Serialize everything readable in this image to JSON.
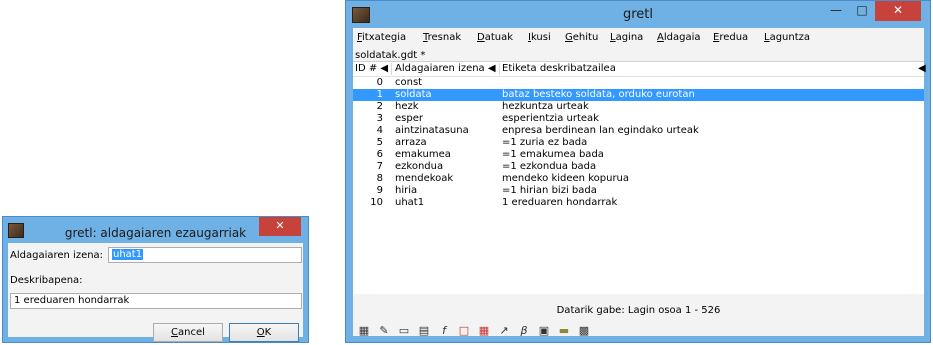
{
  "main_window": {
    "title": "gretl",
    "menus": [
      {
        "label": "Fitxategia",
        "accel": "F",
        "rest": "itxategia"
      },
      {
        "label": "Tresnak",
        "accel": "T",
        "rest": "resnak"
      },
      {
        "label": "Datuak",
        "accel": "D",
        "rest": "atuak"
      },
      {
        "label": "Ikusi",
        "accel": "I",
        "rest": "kusi"
      },
      {
        "label": "Gehitu",
        "accel": "G",
        "rest": "ehitu"
      },
      {
        "label": "Lagina",
        "accel": "L",
        "rest": "agina"
      },
      {
        "label": "Aldagaia",
        "accel": "A",
        "rest": "ldagaia"
      },
      {
        "label": "Eredua",
        "accel": "E",
        "rest": "redua"
      },
      {
        "label": "Laguntza",
        "accel": "L",
        "rest": "aguntza"
      }
    ],
    "file_name": "soldatak.gdt *",
    "columns": {
      "id": "ID #",
      "name": "Aldagaiaren izena",
      "label": "Etiketa deskribatzailea"
    },
    "rows": [
      {
        "id": "0",
        "name": "const",
        "label": ""
      },
      {
        "id": "1",
        "name": "soldata",
        "label": "bataz besteko soldata, orduko eurotan"
      },
      {
        "id": "2",
        "name": "hezk",
        "label": "hezkuntza urteak"
      },
      {
        "id": "3",
        "name": "esper",
        "label": "esperientzia urteak"
      },
      {
        "id": "4",
        "name": "aintzinatasuna",
        "label": "enpresa berdinean lan egindako urteak"
      },
      {
        "id": "5",
        "name": "arraza",
        "label": "=1 zuria ez bada"
      },
      {
        "id": "6",
        "name": "emakumea",
        "label": "=1 emakumea bada"
      },
      {
        "id": "7",
        "name": "ezkondua",
        "label": "=1 ezkondua bada"
      },
      {
        "id": "8",
        "name": "mendekoak",
        "label": "mendeko kideen kopurua"
      },
      {
        "id": "9",
        "name": "hiria",
        "label": "=1 hirian bizi bada"
      },
      {
        "id": "10",
        "name": "uhat1",
        "label": "1 ereduaren hondarrak"
      }
    ],
    "selected_row": "1",
    "status": "Datarik gabe: Lagin osoa 1 - 526",
    "toolbar_icons": [
      "calculator-icon",
      "edit-icon",
      "terminal-icon",
      "session-icon",
      "formula-icon",
      "pdf-icon",
      "table-icon",
      "graph-icon",
      "beta-icon",
      "database-icon",
      "folder-icon",
      "window-icon"
    ]
  },
  "dialog": {
    "title": "gretl: aldagaiaren ezaugarriak",
    "name_label": "Aldagaiaren izena:",
    "name_value": "uhat1",
    "desc_label": "Deskribapena:",
    "desc_value": "1 ereduaren hondarrak",
    "cancel_accel": "C",
    "cancel_rest": "ancel",
    "ok_accel": "O",
    "ok_rest": "K"
  },
  "colors": {
    "titlebar": "#6fb1e4",
    "close": "#c7423a",
    "selection": "#3399ff"
  }
}
